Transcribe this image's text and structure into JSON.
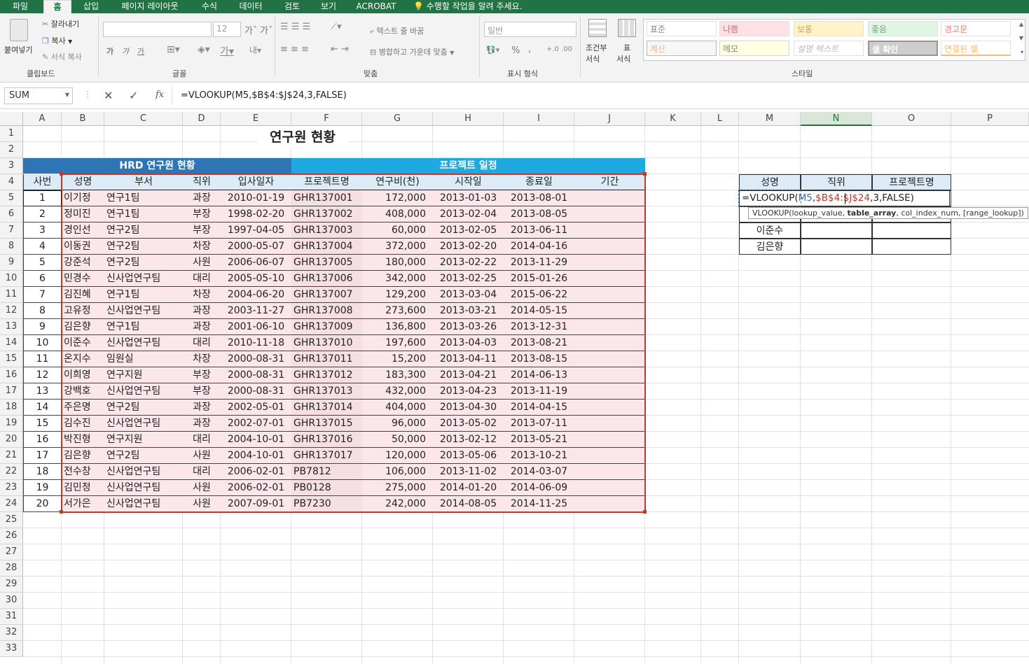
{
  "menu_tabs": [
    "파일",
    "홈",
    "삽입",
    "페이지 레이아웃",
    "수식",
    "데이터",
    "검토",
    "보기",
    "ACROBAT",
    "수행할 작업을 알려 주세요."
  ],
  "ribbon": {
    "clipboard": {
      "paste": "붙여넣기",
      "cut": "잘라내기",
      "copy": "복사",
      "format_painter": "서식 복사",
      "label": "클립보드"
    },
    "font": {
      "font_size": "12",
      "bold": "가",
      "italic": "가",
      "underline": "가",
      "label": "글꼴"
    },
    "alignment": {
      "wrap_text": "텍스트 줄 바꿈",
      "merge_center": "병합하고 가운데 맞춤",
      "label": "맞춤"
    },
    "number": {
      "format": "일반",
      "percent": "%",
      "comma": ",",
      "label": "표시 형식"
    },
    "cond": {
      "conditional": "조건부",
      "conditional2": "서식",
      "table": "표",
      "table2": "서식"
    },
    "styles": {
      "items": [
        [
          "표준",
          "나쁨",
          "보통",
          "좋음",
          "경고문"
        ],
        [
          "계산",
          "메모",
          "설명 텍스트",
          "셀 확인",
          "연결된 셀"
        ]
      ],
      "label": "스타일"
    }
  },
  "formula_bar": {
    "name_box": "SUM",
    "fx": "fx",
    "formula": "=VLOOKUP(M5,$B$4:$J$24,3,FALSE)"
  },
  "columns": [
    "A",
    "B",
    "C",
    "D",
    "E",
    "F",
    "G",
    "H",
    "I",
    "J",
    "K",
    "L",
    "M",
    "N",
    "O",
    "P"
  ],
  "rows": [
    "1",
    "2",
    "3",
    "4",
    "5",
    "6",
    "7",
    "8",
    "9",
    "10",
    "11",
    "12",
    "13",
    "14",
    "15",
    "16",
    "17",
    "18",
    "19",
    "20",
    "21",
    "22",
    "23",
    "24",
    "25",
    "26",
    "27",
    "28",
    "29",
    "30",
    "31",
    "32",
    "33"
  ],
  "sheet": {
    "title": "연구원 현황",
    "section1": "HRD 연구원 현황",
    "section2": "프로젝트 일정",
    "headers": [
      "사번",
      "성명",
      "부서",
      "직위",
      "입사일자",
      "프로젝트명",
      "연구비(천)",
      "시작일",
      "종료일",
      "기간"
    ],
    "records": [
      [
        "1",
        "이기정",
        "연구1팀",
        "과장",
        "2010-01-19",
        "GHR137001",
        "172,000",
        "2013-01-03",
        "2013-08-01"
      ],
      [
        "2",
        "정미진",
        "연구1팀",
        "부장",
        "1998-02-20",
        "GHR137002",
        "408,000",
        "2013-02-04",
        "2013-08-05"
      ],
      [
        "3",
        "경인선",
        "연구2팀",
        "부장",
        "1997-04-05",
        "GHR137003",
        "60,000",
        "2013-02-05",
        "2013-06-11"
      ],
      [
        "4",
        "이동권",
        "연구2팀",
        "차장",
        "2000-05-07",
        "GHR137004",
        "372,000",
        "2013-02-20",
        "2014-04-16"
      ],
      [
        "5",
        "강준석",
        "연구2팀",
        "사원",
        "2006-06-07",
        "GHR137005",
        "180,000",
        "2013-02-22",
        "2013-11-29"
      ],
      [
        "6",
        "민경수",
        "신사업연구팀",
        "대리",
        "2005-05-10",
        "GHR137006",
        "342,000",
        "2013-02-25",
        "2015-01-26"
      ],
      [
        "7",
        "김진혜",
        "연구1팀",
        "차장",
        "2004-06-20",
        "GHR137007",
        "129,200",
        "2013-03-04",
        "2015-06-22"
      ],
      [
        "8",
        "고유정",
        "신사업연구팀",
        "과장",
        "2003-11-27",
        "GHR137008",
        "273,600",
        "2013-03-21",
        "2014-05-15"
      ],
      [
        "9",
        "김은향",
        "연구1팀",
        "과장",
        "2001-06-10",
        "GHR137009",
        "136,800",
        "2013-03-26",
        "2013-12-31"
      ],
      [
        "10",
        "이준수",
        "신사업연구팀",
        "대리",
        "2010-11-18",
        "GHR137010",
        "197,600",
        "2013-04-03",
        "2013-08-21"
      ],
      [
        "11",
        "온지수",
        "임원실",
        "차장",
        "2000-08-31",
        "GHR137011",
        "15,200",
        "2013-04-11",
        "2013-08-15"
      ],
      [
        "12",
        "이희영",
        "연구지원",
        "부장",
        "2000-08-31",
        "GHR137012",
        "183,300",
        "2013-04-21",
        "2014-06-13"
      ],
      [
        "13",
        "강백호",
        "신사업연구팀",
        "부장",
        "2000-08-31",
        "GHR137013",
        "432,000",
        "2013-04-23",
        "2013-11-19"
      ],
      [
        "14",
        "주은명",
        "연구2팀",
        "과장",
        "2002-05-01",
        "GHR137014",
        "404,000",
        "2013-04-30",
        "2014-04-15"
      ],
      [
        "15",
        "김수진",
        "신사업연구팀",
        "과장",
        "2002-07-01",
        "GHR137015",
        "96,000",
        "2013-05-02",
        "2013-07-11"
      ],
      [
        "16",
        "박진형",
        "연구지원",
        "대리",
        "2004-10-01",
        "GHR137016",
        "50,000",
        "2013-02-12",
        "2013-05-21"
      ],
      [
        "17",
        "김은향",
        "연구2팀",
        "사원",
        "2004-10-01",
        "GHR137017",
        "120,000",
        "2013-05-06",
        "2013-10-21"
      ],
      [
        "18",
        "전수창",
        "신사업연구팀",
        "대리",
        "2006-02-01",
        "PB7812",
        "106,000",
        "2013-11-02",
        "2014-03-07"
      ],
      [
        "19",
        "김민정",
        "신사업연구팀",
        "사원",
        "2006-02-01",
        "PB0128",
        "275,000",
        "2014-01-20",
        "2014-06-09"
      ],
      [
        "20",
        "서가은",
        "신사업연구팀",
        "사원",
        "2007-09-01",
        "PB7230",
        "242,000",
        "2014-08-05",
        "2014-11-25"
      ]
    ],
    "lookup": {
      "headers": [
        "성명",
        "직위",
        "프로젝트명"
      ],
      "names": [
        "이준수",
        "김은향"
      ],
      "editing_formula": "=VLOOKUP(M5,$B$4:$J$24,3,FALSE)",
      "tooltip": "VLOOKUP(lookup_value, table_array, col_index_num, [range_lookup])"
    }
  },
  "colors": {
    "green": "#217346",
    "hdr_blue": "#2e75b6",
    "hdr_cyan": "#1fa9e1",
    "light_blue": "#ddebf7",
    "pink": "#fbe7e9",
    "red_border": "#c0392b"
  }
}
